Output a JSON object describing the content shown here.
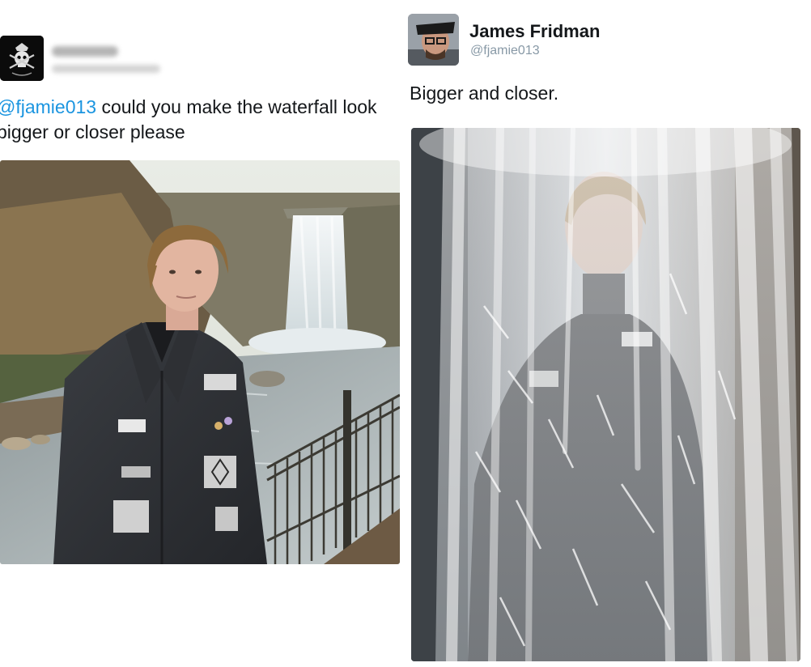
{
  "left_tweet": {
    "avatar": {
      "icon": "skull-emblem-icon",
      "background": "#0b0b0b"
    },
    "name": "",
    "handle": "",
    "text_mention": "@fjamie013",
    "text_body": " could you make the waterfall look bigger or closer please",
    "photo": {
      "subject": "person-in-front-of-waterfall"
    }
  },
  "right_tweet": {
    "avatar": {
      "icon": "user-avatar-icon"
    },
    "name": "James Fridman",
    "handle": "@fjamie013",
    "text": "Bigger and closer.",
    "photo": {
      "subject": "person-under-waterfall-edited"
    }
  },
  "colors": {
    "mention": "#1b95e0",
    "text": "#14171a",
    "handle": "#8899a6"
  }
}
